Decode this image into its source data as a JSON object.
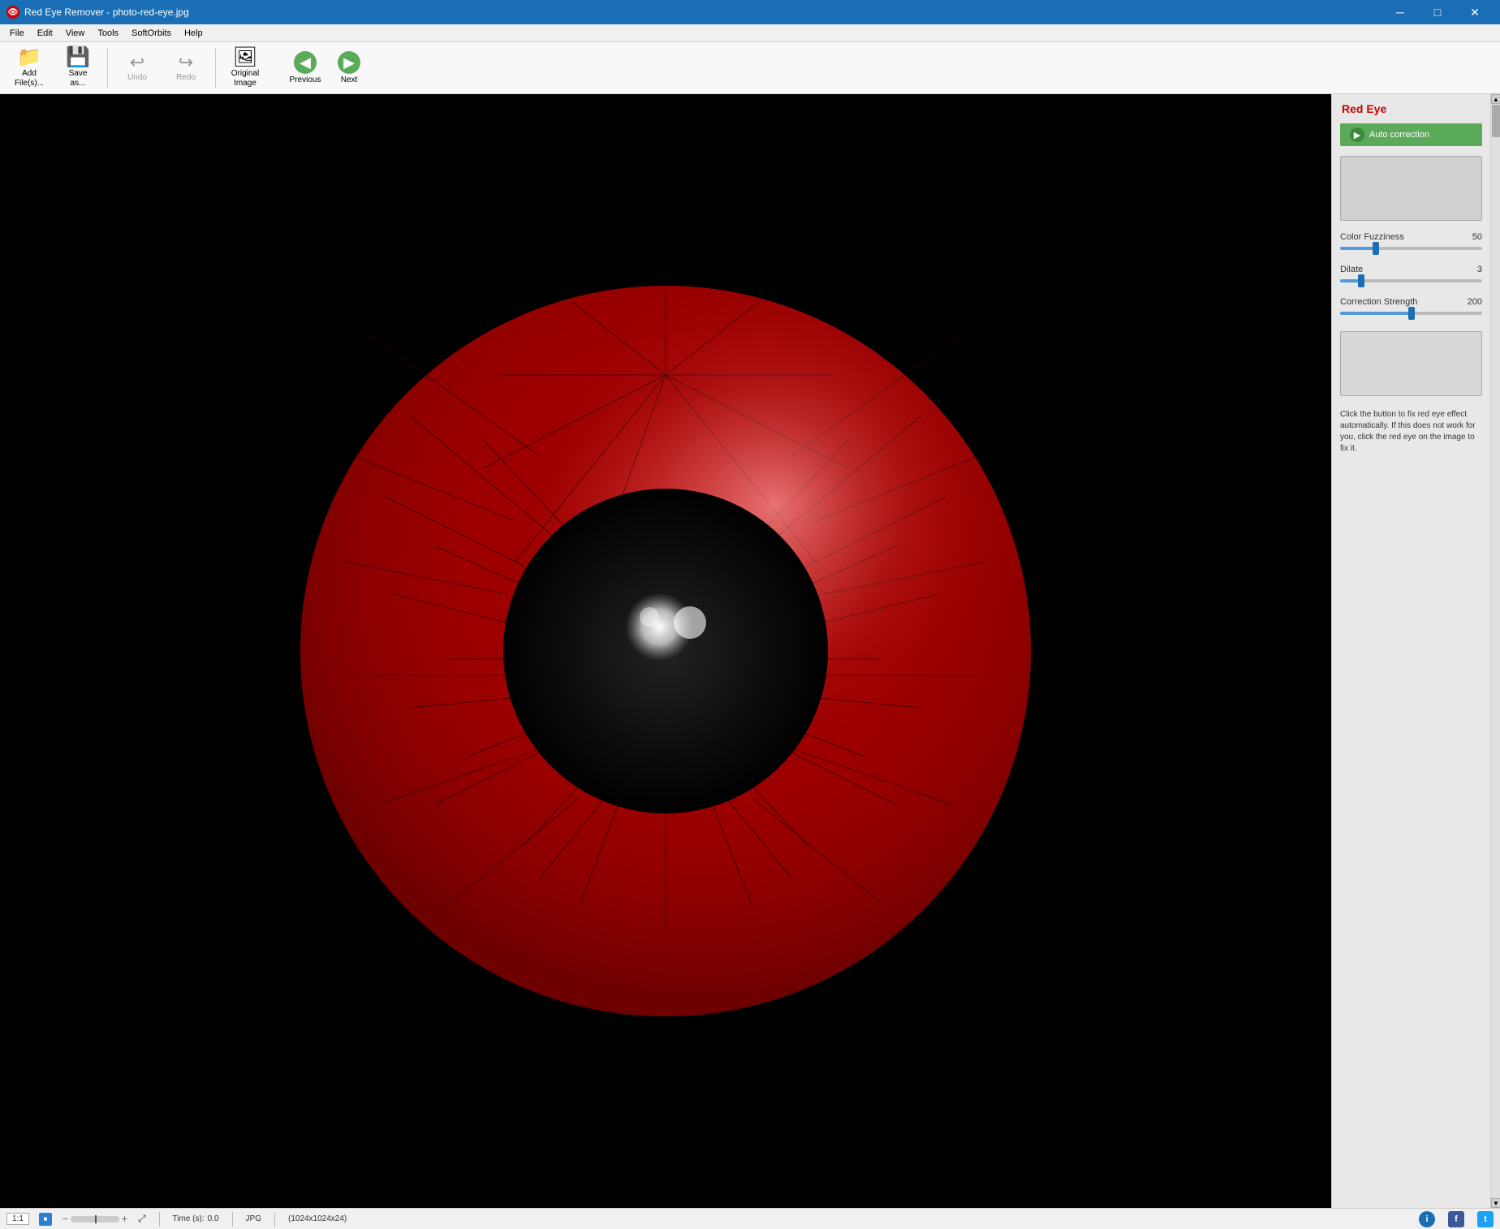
{
  "window": {
    "title": "Red Eye Remover - photo-red-eye.jpg",
    "icon": "eye-icon"
  },
  "titlebar": {
    "minimize": "─",
    "maximize": "□",
    "close": "✕"
  },
  "menubar": {
    "items": [
      {
        "label": "File",
        "id": "menu-file"
      },
      {
        "label": "Edit",
        "id": "menu-edit"
      },
      {
        "label": "View",
        "id": "menu-view"
      },
      {
        "label": "Tools",
        "id": "menu-tools"
      },
      {
        "label": "SoftOrbits",
        "id": "menu-softorbits"
      },
      {
        "label": "Help",
        "id": "menu-help"
      }
    ]
  },
  "toolbar": {
    "buttons": [
      {
        "label": "Add\nFile(s)...",
        "id": "add-files",
        "icon": "📁",
        "disabled": false
      },
      {
        "label": "Save\nas...",
        "id": "save-as",
        "icon": "💾",
        "disabled": false
      },
      {
        "label": "Undo",
        "id": "undo",
        "icon": "↩",
        "disabled": true
      },
      {
        "label": "Redo",
        "id": "redo",
        "icon": "↪",
        "disabled": true
      },
      {
        "label": "Original\nImage",
        "id": "original-image",
        "icon": "🖼",
        "disabled": false
      }
    ],
    "nav": {
      "previous_label": "Previous",
      "next_label": "Next"
    }
  },
  "panel": {
    "title": "Red Eye",
    "auto_correction_label": "Auto correction",
    "sliders": {
      "color_fuzziness": {
        "label": "Color Fuzziness",
        "value": 50,
        "min": 0,
        "max": 200,
        "percent": 25
      },
      "dilate": {
        "label": "Dilate",
        "value": 3,
        "min": 0,
        "max": 20,
        "percent": 15
      },
      "correction_strength": {
        "label": "Correction Strength",
        "value": 200,
        "min": 0,
        "max": 200,
        "percent": 50
      }
    },
    "instruction": "Click the button to fix red eye effect automatically. If this does not work for you, click the red eye on the image to fix it."
  },
  "statusbar": {
    "zoom": "1:1",
    "time_label": "Time (s):",
    "time_value": "0.0",
    "format": "JPG",
    "dimensions": "(1024x1024x24)",
    "icons": {
      "info": "i",
      "facebook": "f",
      "twitter": "t"
    }
  }
}
